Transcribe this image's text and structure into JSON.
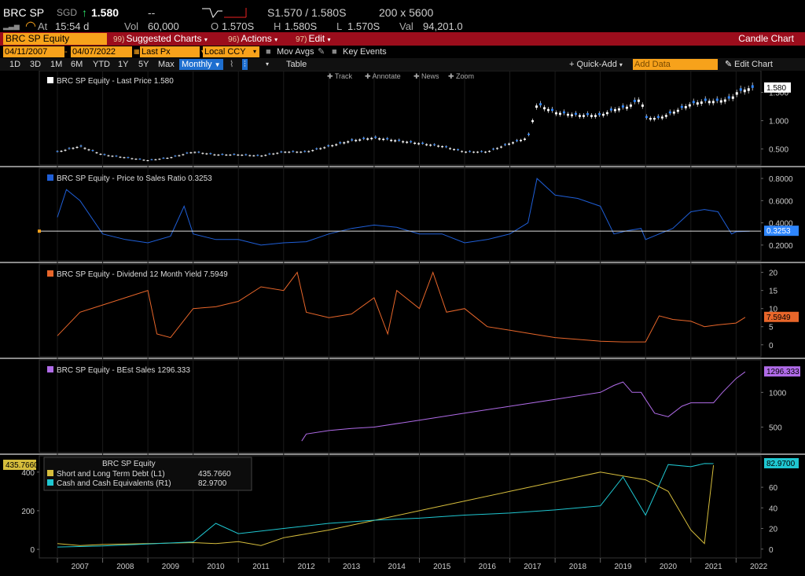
{
  "ticker": {
    "symbol": "BRC SP",
    "currency": "SGD",
    "arrow": "↑",
    "last": "1.580",
    "dashes": "--",
    "bid_ask": "S1.570 / 1.580S",
    "size": "200 x 5600",
    "at_label": "At",
    "time": "15:54 d",
    "vol_label": "Vol",
    "vol": "60,000",
    "o_label": "O",
    "open": "1.570S",
    "h_label": "H",
    "high": "1.580S",
    "l_label": "L",
    "low": "1.570S",
    "val_label": "Val",
    "val": "94,201.0"
  },
  "toolbar": {
    "security": "BRC SP Equity",
    "suggested_num": "99)",
    "suggested": "Suggested Charts",
    "actions_num": "96)",
    "actions": "Actions",
    "edit_num": "97)",
    "edit": "Edit",
    "chart_type": "Candle Chart"
  },
  "controls": {
    "start_date": "04/11/2007",
    "end_date": "04/07/2022",
    "price_field": "Last Px",
    "currency": "Local CCY",
    "mov_avgs": "Mov Avgs",
    "key_events": "Key Events"
  },
  "periods": {
    "items": [
      "1D",
      "3D",
      "1M",
      "6M",
      "YTD",
      "1Y",
      "5Y",
      "Max"
    ],
    "selected": "Monthly",
    "table": "Table",
    "quick_add": "Quick-Add",
    "add_data_placeholder": "Add Data",
    "edit_chart": "Edit Chart"
  },
  "chart_tools": {
    "track": "Track",
    "annotate": "Annotate",
    "news": "News",
    "zoom": "Zoom"
  },
  "colors": {
    "candle_up": "#ffffff",
    "candle_down": "#2e86ff",
    "ps": "#1f5fd8",
    "div": "#e8662a",
    "sales": "#b06be8",
    "debt": "#d6bd3c",
    "cash": "#1fc7d1",
    "red_bar": "#9b0d1c",
    "orange": "#f7a21b"
  },
  "chart_data": [
    {
      "type": "line",
      "title": "BRC SP Equity - Last Price 1.580",
      "series": [
        {
          "name": "Last Price",
          "x": [
            2007.0,
            2007.5,
            2008.0,
            2008.5,
            2009.0,
            2009.5,
            2010.0,
            2010.5,
            2011.0,
            2011.5,
            2012.0,
            2012.5,
            2013.0,
            2013.5,
            2014.0,
            2014.5,
            2015.0,
            2015.5,
            2016.0,
            2016.5,
            2017.0,
            2017.4,
            2017.6,
            2018.0,
            2018.5,
            2019.0,
            2019.3,
            2019.6,
            2019.9,
            2020.0,
            2020.3,
            2020.6,
            2021.0,
            2021.3,
            2021.6,
            2021.9,
            2022.0,
            2022.3
          ],
          "values": [
            0.45,
            0.55,
            0.4,
            0.35,
            0.3,
            0.35,
            0.45,
            0.4,
            0.4,
            0.38,
            0.45,
            0.45,
            0.55,
            0.65,
            0.7,
            0.65,
            0.6,
            0.55,
            0.45,
            0.45,
            0.6,
            0.7,
            1.3,
            1.15,
            1.1,
            1.1,
            1.2,
            1.25,
            1.4,
            1.05,
            1.05,
            1.15,
            1.3,
            1.35,
            1.35,
            1.4,
            1.5,
            1.58
          ]
        }
      ],
      "ylim": [
        0.3,
        1.8
      ],
      "yticks": [
        "0.500",
        "1.000",
        "1.500"
      ],
      "last_label": "1.580"
    },
    {
      "type": "line",
      "title": "BRC SP Equity - Price to Sales Ratio 0.3253",
      "series": [
        {
          "name": "Price to Sales Ratio",
          "x": [
            2007.0,
            2007.2,
            2007.5,
            2008.0,
            2008.5,
            2009.0,
            2009.5,
            2009.8,
            2010.0,
            2010.5,
            2011.0,
            2011.5,
            2012.0,
            2012.5,
            2013.0,
            2013.5,
            2014.0,
            2014.5,
            2015.0,
            2015.5,
            2016.0,
            2016.5,
            2017.0,
            2017.4,
            2017.6,
            2018.0,
            2018.5,
            2019.0,
            2019.3,
            2019.6,
            2019.9,
            2020.0,
            2020.3,
            2020.6,
            2021.0,
            2021.3,
            2021.6,
            2021.9,
            2022.0,
            2022.3
          ],
          "values": [
            0.45,
            0.7,
            0.6,
            0.3,
            0.25,
            0.22,
            0.28,
            0.55,
            0.3,
            0.25,
            0.25,
            0.2,
            0.22,
            0.23,
            0.3,
            0.35,
            0.38,
            0.36,
            0.3,
            0.3,
            0.22,
            0.25,
            0.3,
            0.4,
            0.8,
            0.65,
            0.62,
            0.55,
            0.3,
            0.33,
            0.35,
            0.25,
            0.3,
            0.35,
            0.5,
            0.52,
            0.5,
            0.3,
            0.32,
            0.3253
          ]
        }
      ],
      "ylim": [
        0.1,
        0.85
      ],
      "yticks": [
        "0.2000",
        "0.4000",
        "0.6000",
        "0.8000"
      ],
      "last_label": "0.3253"
    },
    {
      "type": "line",
      "title": "BRC SP Equity - Dividend 12 Month Yield 7.5949",
      "series": [
        {
          "name": "Dividend 12 Month Yield",
          "x": [
            2007.0,
            2007.5,
            2008.0,
            2008.5,
            2009.0,
            2009.2,
            2009.5,
            2010.0,
            2010.5,
            2011.0,
            2011.5,
            2012.0,
            2012.3,
            2012.5,
            2013.0,
            2013.5,
            2014.0,
            2014.3,
            2014.5,
            2015.0,
            2015.3,
            2015.6,
            2016.0,
            2016.5,
            2017.0,
            2017.5,
            2018.0,
            2018.5,
            2019.0,
            2019.5,
            2020.0,
            2020.3,
            2020.6,
            2021.0,
            2021.3,
            2021.6,
            2022.0,
            2022.2
          ],
          "values": [
            2.5,
            9.0,
            11.0,
            13.0,
            15.0,
            3.0,
            2.0,
            10.0,
            10.5,
            12.0,
            16.0,
            15.0,
            20.0,
            9.0,
            7.5,
            8.5,
            13.0,
            3.0,
            15.0,
            10.0,
            20.0,
            9.0,
            10.0,
            5.0,
            4.0,
            3.0,
            2.0,
            1.5,
            1.0,
            0.8,
            0.8,
            8.0,
            7.0,
            6.5,
            5.0,
            5.5,
            6.0,
            7.5949
          ]
        }
      ],
      "ylim": [
        -2,
        21
      ],
      "yticks": [
        "0",
        "5",
        "10",
        "15",
        "20"
      ],
      "last_label": "7.5949"
    },
    {
      "type": "line",
      "title": "BRC SP Equity - BEst Sales 1296.333",
      "series": [
        {
          "name": "BEst Sales",
          "x": [
            2012.4,
            2012.5,
            2013.0,
            2013.5,
            2014.0,
            2015.0,
            2016.0,
            2017.0,
            2018.0,
            2019.0,
            2019.3,
            2019.5,
            2019.7,
            2019.9,
            2020.0,
            2020.2,
            2020.5,
            2020.8,
            2021.0,
            2021.5,
            2021.7,
            2022.0,
            2022.2
          ],
          "values": [
            300,
            400,
            450,
            480,
            500,
            600,
            700,
            800,
            900,
            1000,
            1100,
            1150,
            1000,
            1000,
            900,
            700,
            650,
            800,
            850,
            850,
            1000,
            1200,
            1296.333
          ]
        }
      ],
      "ylim": [
        200,
        1400
      ],
      "yticks": [
        "500",
        "1000"
      ],
      "last_label": "1296.333"
    },
    {
      "type": "line",
      "title": "BRC SP Equity",
      "series": [
        {
          "name": "Short and Long Term Debt (L1)",
          "value_label": "435.7660",
          "x": [
            2007.0,
            2007.5,
            2008.0,
            2009.0,
            2010.0,
            2010.5,
            2011.0,
            2011.5,
            2012.0,
            2013.0,
            2014.0,
            2015.0,
            2016.0,
            2017.0,
            2018.0,
            2019.0,
            2019.5,
            2020.0,
            2020.5,
            2021.0,
            2021.3,
            2021.5
          ],
          "values": [
            30,
            20,
            25,
            30,
            35,
            30,
            40,
            20,
            60,
            100,
            150,
            200,
            250,
            300,
            350,
            400,
            380,
            360,
            300,
            100,
            30,
            435.766
          ]
        },
        {
          "name": "Cash and Cash Equivalents (R1)",
          "value_label": "82.9700",
          "x": [
            2007.0,
            2008.0,
            2009.0,
            2010.0,
            2010.5,
            2011.0,
            2012.0,
            2013.0,
            2014.0,
            2015.0,
            2016.0,
            2017.0,
            2018.0,
            2019.0,
            2019.5,
            2020.0,
            2020.5,
            2021.0,
            2021.3,
            2021.5
          ],
          "values": [
            2,
            3,
            5,
            7,
            25,
            15,
            20,
            25,
            28,
            30,
            33,
            35,
            38,
            42,
            70,
            33,
            82,
            80,
            83,
            82.97
          ]
        }
      ],
      "ylim_left": [
        -20,
        460
      ],
      "ylim_right": [
        -4,
        86
      ],
      "yticks_left": [
        "0",
        "200",
        "400"
      ],
      "yticks_right": [
        "0",
        "20",
        "40",
        "60"
      ],
      "last_label_left": "435.7660",
      "last_label_right": "82.9700"
    }
  ],
  "xaxis": {
    "years": [
      "2007",
      "2008",
      "2009",
      "2010",
      "2011",
      "2012",
      "2013",
      "2014",
      "2015",
      "2016",
      "2017",
      "2018",
      "2019",
      "2020",
      "2021",
      "2022"
    ]
  }
}
